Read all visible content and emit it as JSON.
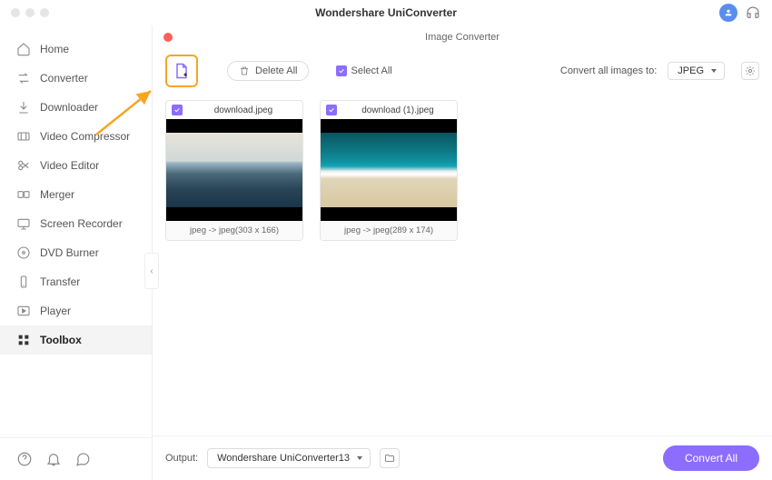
{
  "app": {
    "title": "Wondershare UniConverter"
  },
  "panel": {
    "title": "Image Converter"
  },
  "sidebar": {
    "items": [
      {
        "label": "Home"
      },
      {
        "label": "Converter"
      },
      {
        "label": "Downloader"
      },
      {
        "label": "Video Compressor"
      },
      {
        "label": "Video Editor"
      },
      {
        "label": "Merger"
      },
      {
        "label": "Screen Recorder"
      },
      {
        "label": "DVD Burner"
      },
      {
        "label": "Transfer"
      },
      {
        "label": "Player"
      },
      {
        "label": "Toolbox"
      }
    ]
  },
  "toolbar": {
    "delete_all": "Delete All",
    "select_all": "Select All",
    "convert_to_label": "Convert all images to:",
    "format": "JPEG"
  },
  "cards": [
    {
      "filename": "download.jpeg",
      "conversion": "jpeg -> jpeg(303 x 166)"
    },
    {
      "filename": "download (1).jpeg",
      "conversion": "jpeg -> jpeg(289 x 174)"
    }
  ],
  "output": {
    "label": "Output:",
    "path": "Wondershare UniConverter13"
  },
  "buttons": {
    "convert_all": "Convert All"
  }
}
